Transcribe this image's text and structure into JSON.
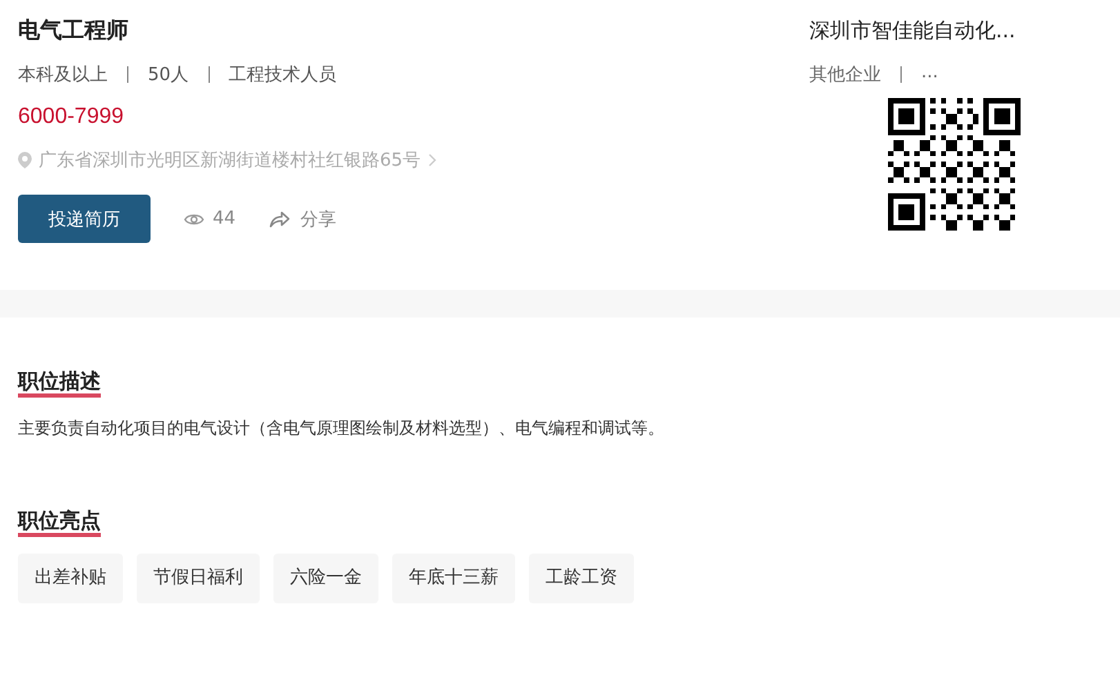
{
  "job": {
    "title": "电气工程师",
    "meta": [
      "本科及以上",
      "50人",
      "工程技术人员"
    ],
    "salary": "6000-7999",
    "address": "广东省深圳市光明区新湖街道楼村社红银路65号",
    "apply_button": "投递简历",
    "views": "44",
    "share": "分享"
  },
  "company": {
    "name": "深圳市智佳能自动化...",
    "meta": [
      "其他企业",
      "..."
    ]
  },
  "sections": [
    {
      "heading": "职位描述",
      "kind": "text",
      "text": "主要负责自动化项目的电气设计（含电气原理图绘制及材料选型）、电气编程和调试等。"
    },
    {
      "heading": "职位亮点",
      "kind": "tags",
      "tags": [
        "出差补贴",
        "节假日福利",
        "六险一金",
        "年底十三薪",
        "工龄工资"
      ]
    }
  ]
}
